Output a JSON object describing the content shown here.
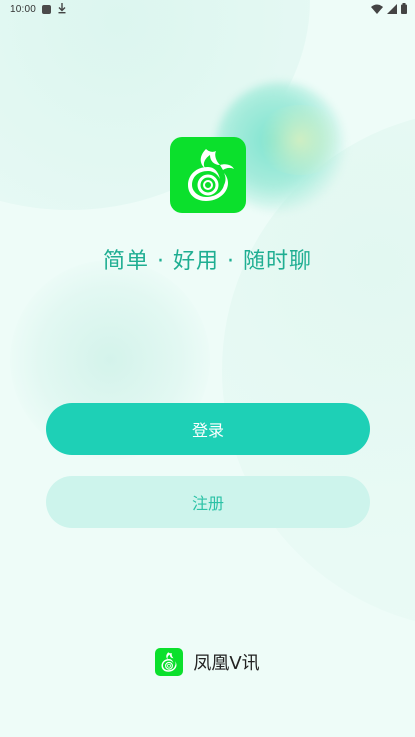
{
  "status_bar": {
    "time": "10:00",
    "icons": [
      "notification-square-icon",
      "download-icon",
      "wifi-icon",
      "signal-icon",
      "battery-icon"
    ]
  },
  "app": {
    "slogan": "简单 · 好用 · 随时聊",
    "brand_name": "凤凰V讯",
    "logo_icon": "phoenix-logo-icon"
  },
  "buttons": {
    "login_label": "登录",
    "register_label": "注册"
  },
  "colors": {
    "primary": "#1ed0b6",
    "primary_light": "#cdf4ec",
    "logo_green": "#0be02c",
    "slogan": "#1fae92",
    "background": "#eefcf8"
  }
}
